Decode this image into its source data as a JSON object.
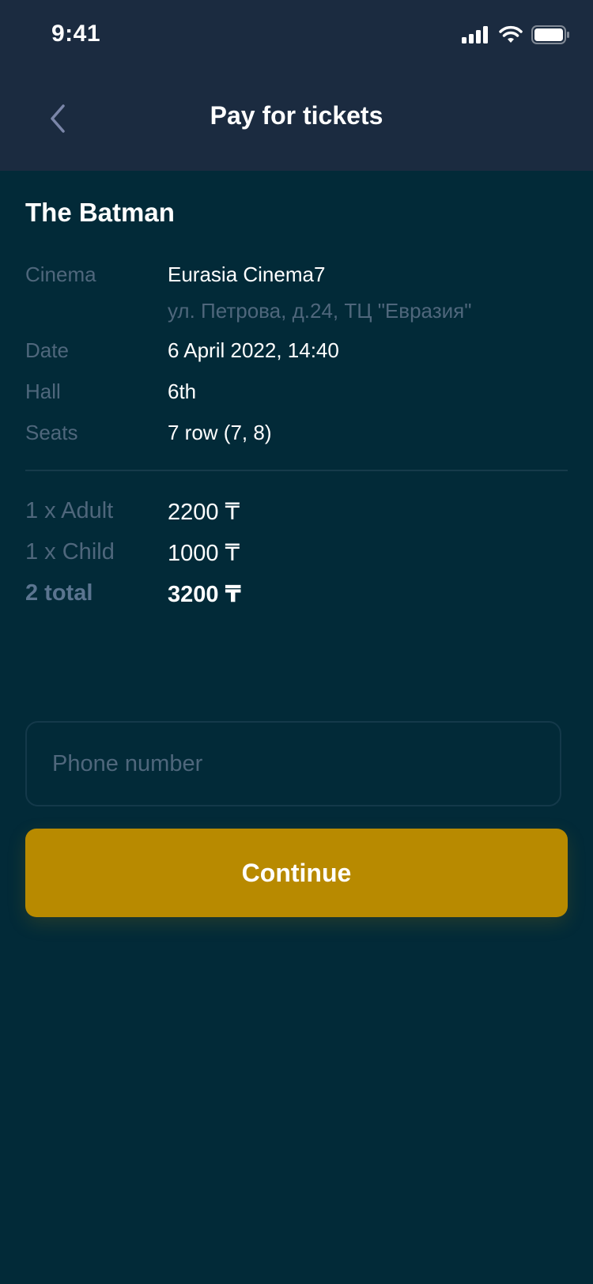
{
  "status_bar": {
    "time": "9:41",
    "icons": [
      "cellular-signal-icon",
      "wifi-icon",
      "battery-icon"
    ]
  },
  "nav": {
    "back_icon": "chevron-left-icon",
    "title": "Pay for tickets"
  },
  "movie": {
    "title": "The Batman"
  },
  "details": {
    "cinema_label": "Cinema",
    "cinema_name": "Eurasia Cinema7",
    "cinema_address": "ул. Петрова, д.24, ТЦ \"Евразия\"",
    "date_label": "Date",
    "date_value": "6 April 2022, 14:40",
    "hall_label": "Hall",
    "hall_value": "6th",
    "seats_label": "Seats",
    "seats_value": "7 row (7, 8)"
  },
  "pricing": {
    "adult_label": "1 x Adult",
    "adult_price": "2200 ₸",
    "child_label": "1 x Child",
    "child_price": "1000 ₸",
    "total_label": "2 total",
    "total_price": "3200 ₸"
  },
  "phone": {
    "placeholder": "Phone number",
    "value": ""
  },
  "actions": {
    "continue_label": "Continue"
  },
  "colors": {
    "background": "#022a38",
    "header": "#1b2b40",
    "accent": "#b88a00",
    "muted_text": "#4f677c"
  }
}
